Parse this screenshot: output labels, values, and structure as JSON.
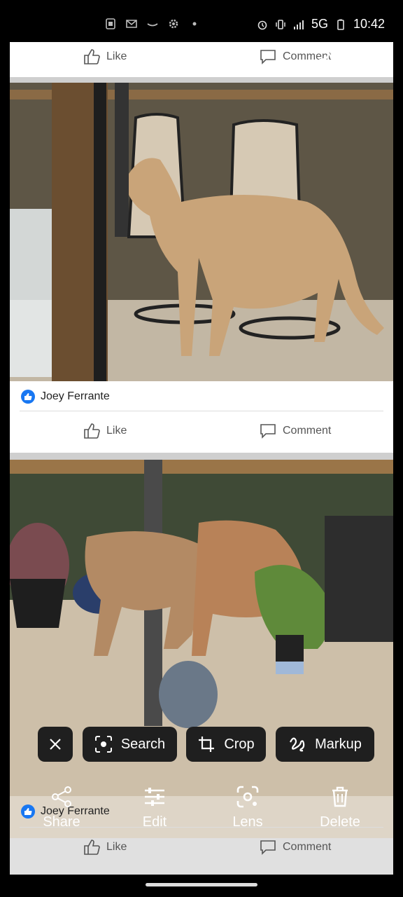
{
  "status_bar": {
    "time": "10:42",
    "network": "5G"
  },
  "fb_post_top": {
    "like_label": "Like",
    "comment_label": "Comment"
  },
  "fb_post_1": {
    "author": "Joey Ferrante",
    "like_label": "Like",
    "comment_label": "Comment"
  },
  "fb_post_2": {
    "author": "Joey Ferrante",
    "like_label": "Like",
    "comment_label": "Comment"
  },
  "chips": {
    "search_label": "Search",
    "crop_label": "Crop",
    "markup_label": "Markup"
  },
  "actions": {
    "share_label": "Share",
    "edit_label": "Edit",
    "lens_label": "Lens",
    "delete_label": "Delete"
  },
  "colors": {
    "facebook_blue": "#1877f2",
    "chip_bg": "#1f1f1f"
  }
}
